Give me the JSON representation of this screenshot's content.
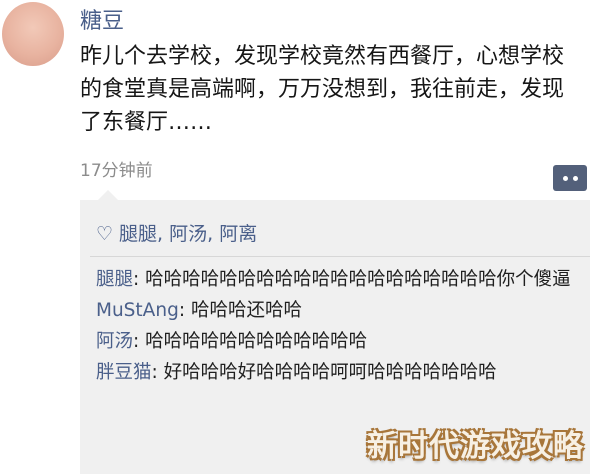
{
  "post": {
    "username": "糖豆",
    "text": "昨儿个去学校，发现学校竟然有西餐厅，心想学校的食堂真是高端啊，万万没想到，我往前走，发现了东餐厅……",
    "time": "17分钟前"
  },
  "likes": {
    "icon": "heart-outline-icon",
    "names": "腿腿, 阿汤, 阿离"
  },
  "comments": [
    {
      "author": "腿腿",
      "separator": ": ",
      "text": "哈哈哈哈哈哈哈哈哈哈哈哈哈哈哈哈哈哈哈你个傻逼"
    },
    {
      "author": "MuStAng",
      "separator": ": ",
      "text": "哈哈哈还哈哈"
    },
    {
      "author": "阿汤",
      "separator": ": ",
      "text": "哈哈哈哈哈哈哈哈哈哈哈哈"
    },
    {
      "author": "胖豆猫",
      "separator": ": ",
      "text": "好哈哈哈好哈哈哈哈呵呵哈哈哈哈哈哈哈"
    }
  ],
  "comment_button": {
    "icon": "comment-dots-icon"
  },
  "watermark": "新时代游戏攻略",
  "colors": {
    "name_link": "#4a5f8a",
    "comment_button_bg": "#53607a",
    "interaction_bg": "#f0f0f0",
    "timestamp": "#8c8c8c"
  }
}
